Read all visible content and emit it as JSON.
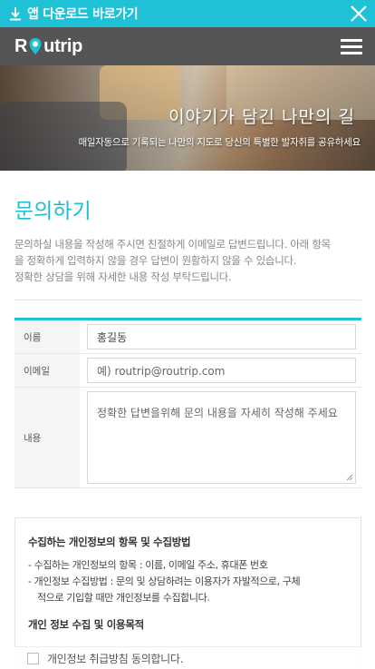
{
  "app_banner": {
    "download_label": "앱 다운로드 바로가기",
    "download_icon": "download-icon",
    "close_icon": "close-icon"
  },
  "nav": {
    "logo_text_left": "R",
    "logo_text_right": "utrip",
    "logo_pin_icon": "map-pin-icon",
    "menu_icon": "hamburger-menu-icon"
  },
  "hero": {
    "title": "이야기가 담긴 나만의 길",
    "subtitle": "매일자동으로 기록되는 나만의 지도로 당신의 특별한 발자취를 공유하세요"
  },
  "page": {
    "title": "문의하기",
    "intro_line1": "문의하실 내용을 작성해 주시면 친절하게 이메일로 답변드립니다. 아래 항목",
    "intro_line2": "을 정확하게 입력하지 않을 경우 답변이 원활하지 않을 수 있습니다.",
    "intro_line3": "정확한 상담을 위해 자세한 내용 작성 부탁드립니다."
  },
  "form": {
    "name_label": "이름",
    "name_value": "홍길동",
    "email_label": "이메일",
    "email_placeholder": "예) routrip@routrip.com",
    "content_label": "내용",
    "content_placeholder": "정확한 답변을위해 문의 내용을 자세히 작성해 주세요"
  },
  "policy": {
    "heading1": "수집하는 개인정보의 항목 및 수집방법",
    "item1": "- 수집하는 개인정보의 항목 : 이름, 이메일 주소, 휴대폰 번호",
    "item2a": "- 개인정보 수집방법 : 문의 및 상담하려는 이용자가 자발적으로, 구체",
    "item2b": "적으로 기입할 때만 개인정보를 수집합니다.",
    "heading2": "개인 정보 수집 및 이용목적",
    "agree_label": "개인정보 취급방침 동의합니다."
  },
  "colors": {
    "accent": "#1fc1d6",
    "nav_bg": "#555555"
  }
}
